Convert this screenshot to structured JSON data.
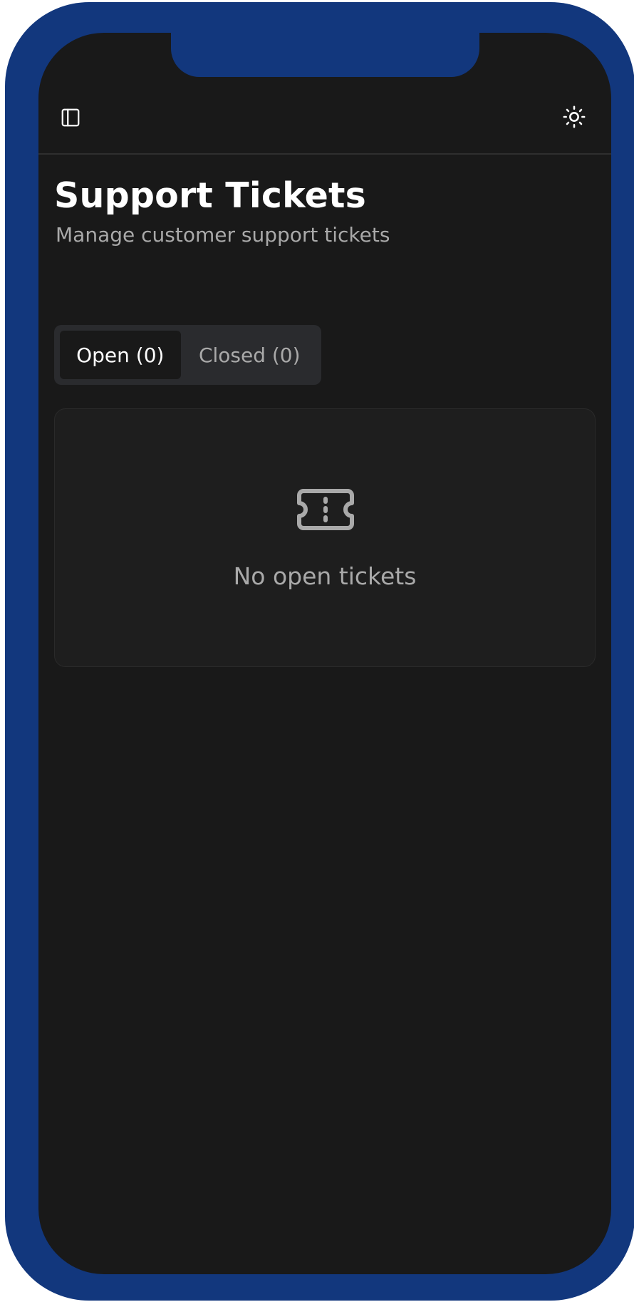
{
  "header": {
    "sidebar_toggle_icon": "sidebar-panel-icon",
    "theme_toggle_icon": "sun-icon"
  },
  "page": {
    "title": "Support Tickets",
    "subtitle": "Manage customer support tickets"
  },
  "tabs": [
    {
      "label": "Open (0)",
      "active": true
    },
    {
      "label": "Closed (0)",
      "active": false
    }
  ],
  "empty_state": {
    "icon": "ticket-icon",
    "message": "No open tickets"
  },
  "colors": {
    "device_frame": "#12377d",
    "screen_bg": "#191919",
    "card_bg": "#1e1e1e",
    "tabs_bg": "#2a2b2e",
    "text_primary": "#ffffff",
    "text_muted": "#a9a9a9"
  }
}
